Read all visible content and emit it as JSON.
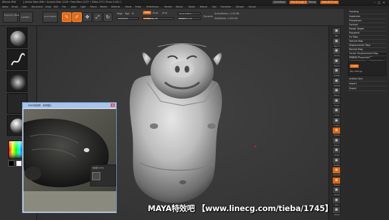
{
  "titlebar": {
    "app_title": "ZBrush 4R6",
    "path_text": "[ Active Mem 698 • Scratch Disk 1226 • Free Mem 2137 • Zfiles 2771 Timer 0.001 ]",
    "quicksave_label": "QuickSave",
    "see_through_label": "See-through 0",
    "menus_label": "Menus",
    "default_script_label": "DefaultZScript"
  },
  "menubar": [
    "Alpha",
    "Brush",
    "Color",
    "Document",
    "Draw",
    "Edit",
    "File",
    "Layer",
    "Light",
    "Macro",
    "Marker",
    "Material",
    "Movie",
    "Picker",
    "Preferences",
    "Render",
    "Stencil",
    "Stroke",
    "Texture",
    "Tool",
    "Transform",
    "Zplugin",
    "Zscript"
  ],
  "toolbar": {
    "projection_master": "Projection Master",
    "lightbox": "LightBox",
    "quick_sketch": "Quick Sketch",
    "edit": "Edit",
    "draw": "Draw",
    "move": "Move",
    "scale": "Scale",
    "rotate": "Rotate",
    "mrgb": "Mrgb",
    "rgb": "Rgb",
    "m": "M",
    "zadd": "Zadd",
    "zsub": "Zsub",
    "zcut": "Zcut",
    "z_intensity": "Z Intensity 25",
    "focal_shift": "Focal Shift 0",
    "draw_size": "Draw Size 64",
    "dynamic": "Dynamic",
    "active_points": "ActivePoints: 1.232 Mil",
    "total_points": "TotalPoints: 2.434 Mil"
  },
  "rightpanel": {
    "items": [
      "Tracking",
      "Subdivide",
      "Polygroups",
      "Contact",
      "Morph Target",
      "Polypaint",
      "UV Map",
      "Texture Map",
      "Displacement Map",
      "Normal Map",
      "Vector Displacement Map",
      "Display Properties",
      "Unified Skin",
      "Import",
      "Export"
    ],
    "subsection_label": "Smooth N",
    "mid_label": "Mid",
    "orange_btn": "Create",
    "zdo_label": "ZDo Settings"
  },
  "rightstrip": [
    "Bpr",
    "Spix 3",
    "Scroll",
    "Zoom",
    "Actual",
    "AAHalf",
    "Persp",
    "Floor",
    "Local",
    "L.Sym",
    "Frame",
    "Move",
    "Scale",
    "Rotate",
    "Line Fill",
    "Transp",
    "Ghost",
    "Solo",
    "Xpose"
  ],
  "leftshelf": {
    "tiles": [
      "brush-standard",
      "stroke-freehand",
      "alpha-off",
      "texture-off",
      "material-matcap",
      "color-picker"
    ]
  },
  "refwin": {
    "title": "MAYA特效吧 - 参考图片",
    "caption": "当前图 100%"
  },
  "watermark": "MAYA特效吧  【www.linecg.com/tieba/1745】"
}
